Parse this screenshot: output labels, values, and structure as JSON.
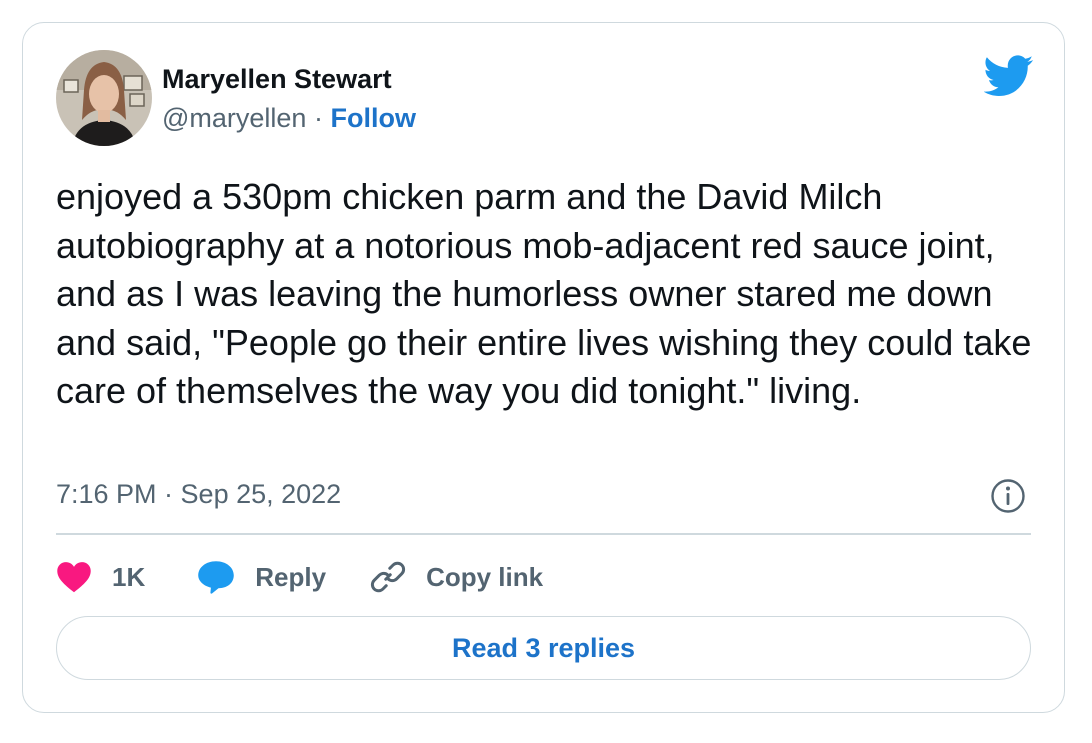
{
  "author": {
    "name": "Maryellen Stewart",
    "handle": "@maryellen",
    "separator": "·",
    "follow_label": "Follow"
  },
  "tweet": {
    "text": "enjoyed a 530pm chicken parm and the David Milch autobiography at a notorious mob-adjacent red sauce joint, and as I was leaving the humorless owner stared me down and said, \"People go their entire lives wishing they could take care of themselves the way you did tonight.\" living.",
    "timestamp": "7:16 PM · Sep 25, 2022"
  },
  "actions": {
    "like_count": "1K",
    "reply_label": "Reply",
    "copy_link_label": "Copy link"
  },
  "read_replies_label": "Read 3 replies",
  "icons": {
    "brand": "twitter-bird-icon",
    "like": "heart-icon",
    "reply": "speech-bubble-icon",
    "copy": "link-icon",
    "info": "info-icon"
  },
  "colors": {
    "twitter_blue": "#1d9bf0",
    "link_blue": "#1d73c9",
    "heart_pink": "#f91880",
    "muted_text": "#536471",
    "border": "#cfd9de"
  }
}
